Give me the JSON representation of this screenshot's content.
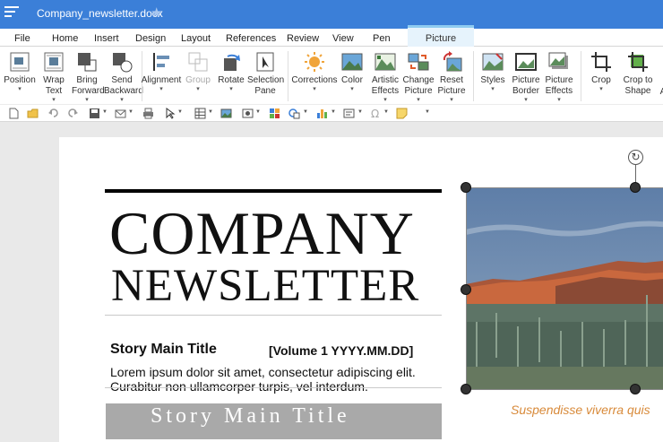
{
  "titlebar": {
    "doc_title": "Company_newsletter.docx",
    "menu_icon": "hamburger-icon",
    "star_icon": "star-icon"
  },
  "tabs": [
    "File",
    "Home",
    "Insert",
    "Design",
    "Layout",
    "References",
    "Review",
    "View",
    "Pen",
    "Picture"
  ],
  "ribbon": {
    "position": [
      "Position"
    ],
    "wrap_text": [
      "Wrap",
      "Text"
    ],
    "bring_forward": [
      "Bring",
      "Forward"
    ],
    "send_backward": [
      "Send",
      "Backward"
    ],
    "alignment": [
      "Alignment"
    ],
    "group": [
      "Group"
    ],
    "rotate": [
      "Rotate"
    ],
    "selection_pane": [
      "Selection",
      "Pane"
    ],
    "corrections": [
      "Corrections"
    ],
    "color": [
      "Color"
    ],
    "artistic_effects": [
      "Artistic",
      "Effects"
    ],
    "change_picture": [
      "Change",
      "Picture"
    ],
    "reset_picture": [
      "Reset",
      "Picture"
    ],
    "styles": [
      "Styles"
    ],
    "picture_border": [
      "Picture",
      "Border"
    ],
    "picture_effects": [
      "Picture",
      "Effects"
    ],
    "crop": [
      "Crop"
    ],
    "crop_to_shape": [
      "Crop to",
      "Shape"
    ],
    "clipped_label": "A"
  },
  "document": {
    "heading_line1": "COMPANY",
    "heading_line2": "NEWSLETTER",
    "story_title": "Story Main Title",
    "volume": "[Volume 1 YYYY.MM.DD]",
    "body_line1": "Lorem ipsum dolor sit amet, consectetur adipiscing elit.",
    "body_line2": "Curabitur non ullamcorper turpis, vel interdum.",
    "band_title": "Story Main Title",
    "caption": "Suspendisse viverra quis"
  },
  "colors": {
    "titlebar": "#3b7fd8",
    "picture_tab": "#e6f3fc",
    "caption": "#d88a3a"
  }
}
